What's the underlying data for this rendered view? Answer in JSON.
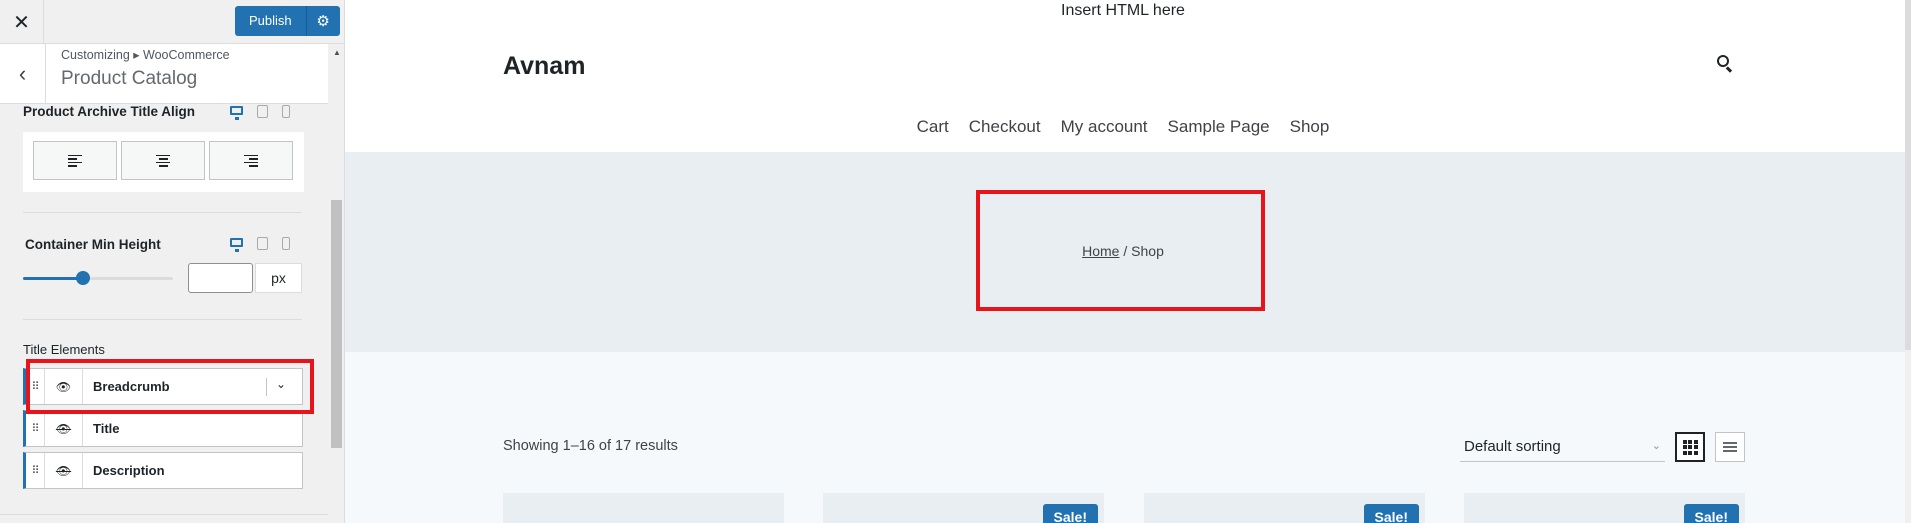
{
  "sidebar": {
    "close_label": "✕",
    "publish_label": "Publish",
    "gear_glyph": "⚙",
    "back_glyph": "‹",
    "breadcrumb": "Customizing ▸ WooCommerce",
    "section_title": "Product Catalog",
    "title_align_label": "Product Archive Title Align",
    "min_height_label": "Container Min Height",
    "min_height_value": "",
    "min_height_unit": "px",
    "min_height_slider_fraction": 0.4,
    "title_elements_label": "Title Elements",
    "elements": [
      {
        "name": "Breadcrumb",
        "visible": true,
        "eye": "👁"
      },
      {
        "name": "Title",
        "visible": false,
        "eye": "👁"
      },
      {
        "name": "Description",
        "visible": false,
        "eye": "👁"
      }
    ],
    "drag_glyph": "⠿",
    "chevron_glyph": "⌄",
    "accent_color": "#2271b1",
    "highlight_color": "#e8141b"
  },
  "preview": {
    "top_bar_text": "Insert HTML here",
    "site_title": "Avnam",
    "nav": [
      "Cart",
      "Checkout",
      "My account",
      "Sample Page",
      "Shop"
    ],
    "breadcrumb_home": "Home",
    "breadcrumb_sep": " / ",
    "breadcrumb_current": "Shop",
    "results_text": "Showing 1–16 of 17 results",
    "sorting_selected": "Default sorting",
    "sale_badge": "Sale!"
  }
}
